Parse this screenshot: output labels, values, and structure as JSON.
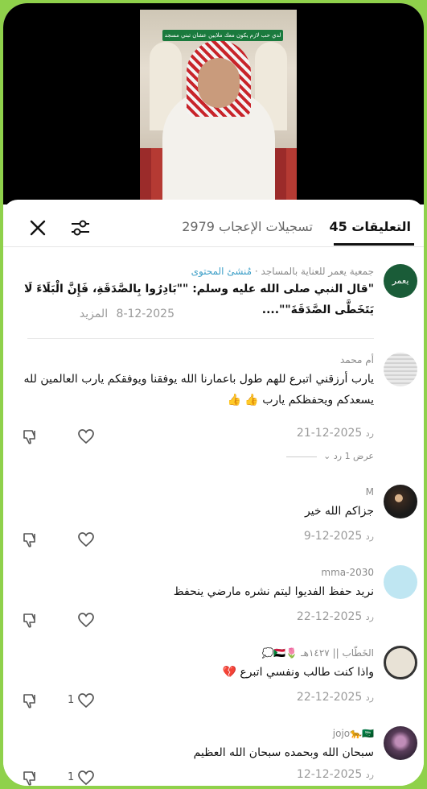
{
  "video": {
    "caption": "لدي حب لازم يكون معك ملايين عشان تبني مسجد"
  },
  "tabs": {
    "comments_label": "التعليقات 45",
    "likes_label": "تسجيلات الإعجاب 2979"
  },
  "icons": {
    "close": "close-icon",
    "filter": "filter-icon"
  },
  "comments": [
    {
      "avatar_text": "يعمر",
      "name": "جمعية يعمر للعناية بالمساجد",
      "badge": "مُنشئ المحتوى",
      "text": "\"قال النبي صلى الله عليه وسلم: \"\"بَادِرُوا بِالصَّدَقَةِ، فَإِنَّ الْبَلَاءَ لَا يَتَخَطَّى الصَّدَقَةَ\"\"....",
      "date": "8-12-2025",
      "more": "المزيد"
    },
    {
      "name": "أم محمد",
      "text": "يارب أرزقني اتبرع للهم طول باعمارنا الله يوفقنا ويوفقكم يارب العالمين لله يسعدكم ويحفظكم يارب 👍 👍",
      "date": "2025-12-21",
      "reply": "رد",
      "view_replies": "عرض 1 رد"
    },
    {
      "name": "M",
      "text": "جزاكم الله خير",
      "date": "2025-12-9",
      "reply": "رد"
    },
    {
      "name": "mma-2030",
      "text": "نريد حفظ الفديوا ليتم نشره مارضي ينحفظ",
      "date": "2025-12-22",
      "reply": "رد"
    },
    {
      "name": "الخَطّاب || ١٤٢٧هـ 🌷🇸🇩💭",
      "text": "واذا كنت طالب ونفسي اتبرع 💔",
      "date": "2025-12-22",
      "reply": "رد",
      "likes": "1"
    },
    {
      "name": "jojo🐆🇸🇦",
      "text": "سبحان الله وبحمده سبحان الله العظيم",
      "date": "2025-12-12",
      "reply": "رد",
      "likes": "1"
    }
  ],
  "colors": {
    "accent_green": "#1a5c38",
    "creator_badge": "#3fa0c8",
    "border_green": "#8fd14b"
  }
}
